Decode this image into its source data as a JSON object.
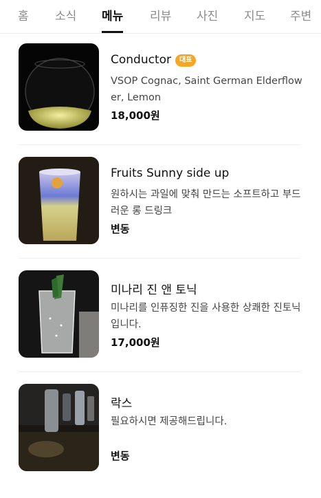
{
  "tabs": [
    {
      "label": "홈"
    },
    {
      "label": "소식"
    },
    {
      "label": "메뉴"
    },
    {
      "label": "리뷰"
    },
    {
      "label": "사진"
    },
    {
      "label": "지도"
    },
    {
      "label": "주변"
    }
  ],
  "active_tab": "메뉴",
  "menu": {
    "items": [
      {
        "name": "Conductor",
        "badge": "대표",
        "description": "VSOP Cognac, Saint German Elderflower, Lemon",
        "price": "18,000원"
      },
      {
        "name": "Fruits Sunny side up",
        "description": "원하시는 과일에 맞춰 만드는 소프트하고 부드러운 롱 드링크",
        "price": "변동"
      },
      {
        "name": "미나리 진 앤 토닉",
        "description": "미나리를 인퓨징한 진을 사용한 상쾌한 진토닉입니다.",
        "price": "17,000원"
      },
      {
        "name": "락스",
        "description": "필요하시면 제공해드립니다.",
        "price": "변동"
      }
    ]
  },
  "colors": {
    "badge": "#f5a623",
    "active_tab": "#111111",
    "inactive_tab": "#8a8a8a"
  }
}
